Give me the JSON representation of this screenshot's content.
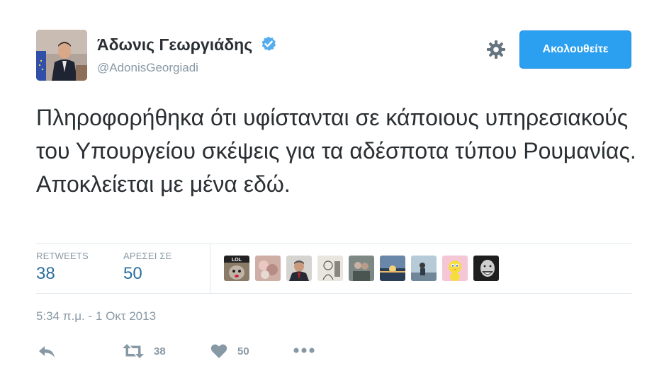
{
  "user": {
    "display_name": "Άδωνις Γεωργιάδης",
    "screen_name": "@AdonisGeorgiadi",
    "verified": true
  },
  "follow_button": {
    "label": "Ακολουθείτε"
  },
  "tweet": {
    "text": "Πληροφορήθηκα ότι υφίστανται σε κάποιους υπηρεσιακούς του Υπουργείου σκέψεις για τα αδέσποτα τύπου Ρουμανίας. Αποκλείεται με μένα εδώ.",
    "timestamp": "5:34 π.μ. - 1 Οκτ 2013"
  },
  "stats": {
    "retweets": {
      "label": "RETWEETS",
      "value": "38"
    },
    "likes": {
      "label": "ΑΡΕΣΕΙ ΣΕ",
      "value": "50"
    }
  },
  "liker_avatars": [
    {
      "name": "lol-cat",
      "color": "#7a6a5a",
      "text": "LOL"
    },
    {
      "name": "flowers",
      "color": "#c9a6a0"
    },
    {
      "name": "man-suit",
      "color": "#3a3f4a"
    },
    {
      "name": "sketch",
      "color": "#d8d4cc"
    },
    {
      "name": "couple",
      "color": "#7f8a86"
    },
    {
      "name": "sunset",
      "color": "#3c5a7a"
    },
    {
      "name": "pier",
      "color": "#a9bfd0"
    },
    {
      "name": "tweety",
      "color": "#f2c8d8"
    },
    {
      "name": "smiling-man",
      "color": "#2a2a2a"
    }
  ],
  "actions": {
    "retweet_count": "38",
    "like_count": "50"
  },
  "colors": {
    "accent": "#2b9ff0",
    "muted": "#8899a6",
    "stat_value": "#2a6f9e",
    "verified": "#55acee"
  }
}
